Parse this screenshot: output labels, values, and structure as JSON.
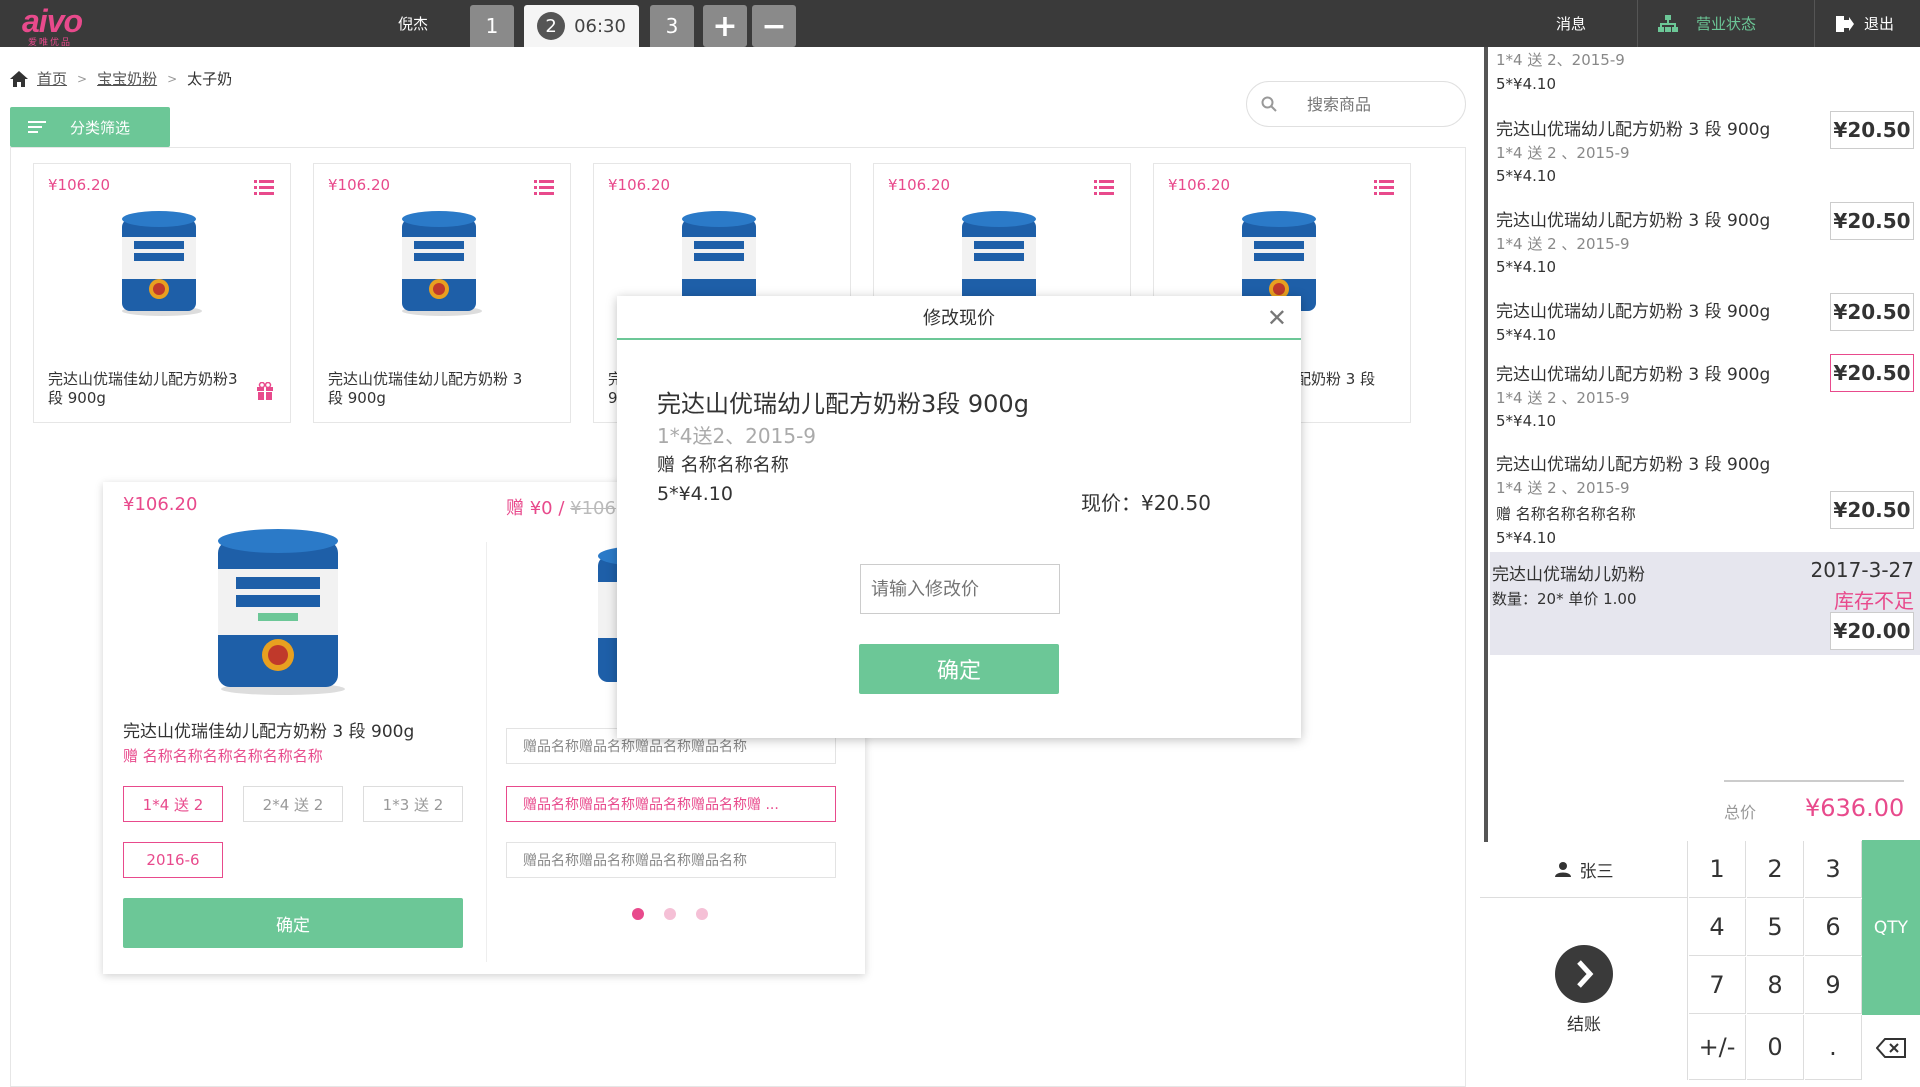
{
  "app": {
    "logo_text": "aivo",
    "logo_sub": "爱唯优品",
    "user_name": "倪杰",
    "tabs": [
      {
        "label": "1"
      },
      {
        "label": "2",
        "time": "06:30"
      },
      {
        "label": "3"
      }
    ],
    "add_tab_label": "+",
    "remove_tab_label": "−",
    "messages_label": "消息",
    "status_label": "营业状态",
    "logout_label": "退出",
    "accent_color": "#6cc797",
    "brand_color": "#e84a8c"
  },
  "breadcrumb": {
    "home": "首页",
    "category": "宝宝奶粉",
    "current": "太子奶",
    "separator": ">"
  },
  "search": {
    "placeholder": "搜索商品"
  },
  "filter": {
    "label": "分类筛选"
  },
  "cards": [
    {
      "price": "¥106.20",
      "name": "完达山优瑞佳幼儿配方奶粉3 段 900g"
    },
    {
      "price": "¥106.20",
      "name": "完达山优瑞佳幼儿配方奶粉 3 段 900g"
    },
    {
      "price": "¥106.20",
      "name": "完\n9"
    },
    {
      "price": "¥106.20",
      "name": ""
    },
    {
      "price": "¥106.20",
      "name": "配奶粉 3 段"
    }
  ],
  "product_popup": {
    "price": "¥106.20",
    "name": "完达山优瑞佳幼儿配方奶粉 3 段 900g",
    "gift": "赠 名称名称名称名称名称名称",
    "options": [
      "1*4 送 2",
      "2*4 送 2",
      "1*3 送 2",
      "2016-6"
    ],
    "confirm": "确定",
    "gift_head": "赠 ¥0 / ",
    "gift_head_strike": "¥106",
    "gift_items": [
      "赠品名称赠品名称赠品名称赠品名称",
      "赠品名称赠品名称赠品名称赠品名称赠 ...",
      "赠品名称赠品名称赠品名称赠品名称"
    ]
  },
  "modal": {
    "title": "修改现价",
    "close": "✕",
    "name": "完达山优瑞幼儿配方奶粉3段 900g",
    "spec": "1*4送2、2015-9",
    "gift": "赠   名称名称名称",
    "qty": "5*¥4.10",
    "current_price": "现价：¥20.50",
    "input_placeholder": "请输入修改价",
    "ok": "确定"
  },
  "order": {
    "top_fragment_spec": "1*4 送 2、2015-9",
    "top_fragment_qty": "5*¥4.10",
    "items": [
      {
        "name": "完达山优瑞幼儿配方奶粉 3 段 900g",
        "spec": "1*4 送 2 、2015-9",
        "qty": "5*¥4.10",
        "price": "¥20.50"
      },
      {
        "name": "完达山优瑞幼儿配方奶粉 3 段 900g",
        "spec": "1*4 送 2 、2015-9",
        "qty": "5*¥4.10",
        "price": "¥20.50"
      },
      {
        "name": "完达山优瑞幼儿配方奶粉 3 段 900g",
        "spec": "",
        "qty": "5*¥4.10",
        "price": "¥20.50"
      },
      {
        "name": "完达山优瑞幼儿配方奶粉 3 段 900g",
        "spec": "1*4 送 2 、2015-9",
        "qty": "5*¥4.10",
        "price": "¥20.50"
      },
      {
        "name": "完达山优瑞幼儿配方奶粉 3 段 900g",
        "spec": "1*4 送 2 、2015-9",
        "gift": "赠 名称名称名称名称",
        "qty": "5*¥4.10",
        "price": "¥20.50"
      }
    ],
    "low_stock": {
      "name": "完达山优瑞幼儿奶粉",
      "date": "2017-3-27",
      "detail": "数量：20* 单价 1.00",
      "warning": "库存不足",
      "price": "¥20.00"
    },
    "total_label": "总价",
    "total": "¥636.00"
  },
  "keypad": {
    "member": "张三",
    "checkout": "结账",
    "keys": [
      "1",
      "2",
      "3",
      "4",
      "5",
      "6",
      "7",
      "8",
      "9",
      "+/-",
      "0",
      "."
    ],
    "qty": "QTY"
  }
}
